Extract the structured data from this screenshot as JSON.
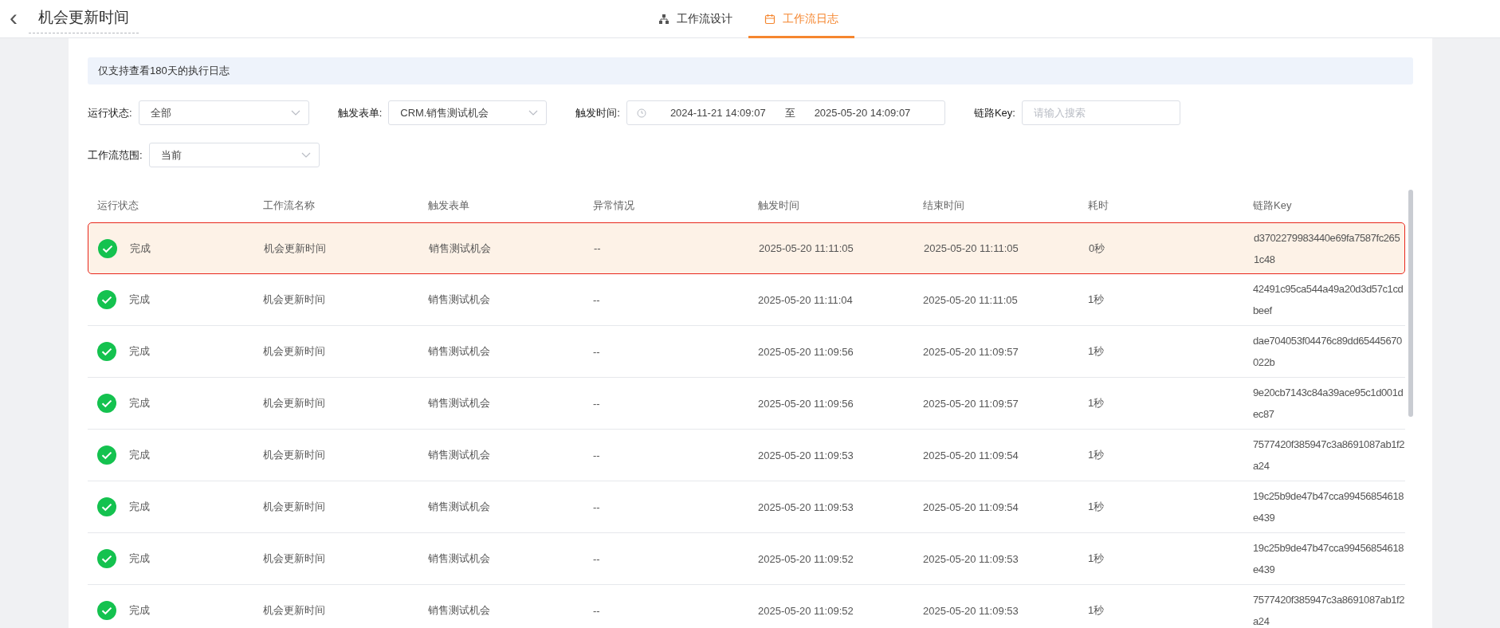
{
  "header": {
    "back": "‹",
    "title": "机会更新时间",
    "tabs": [
      {
        "label": "工作流设计",
        "kind": "flow",
        "selected": false
      },
      {
        "label": "工作流日志",
        "kind": "calendar",
        "selected": true
      }
    ]
  },
  "notice": "仅支持查看180天的执行日志",
  "filters": [
    {
      "label": "运行状态:",
      "kind": "select",
      "value": "全部"
    },
    {
      "label": "触发表单:",
      "kind": "select",
      "value": "CRM.销售测试机会"
    },
    {
      "label": "触发时间:",
      "kind": "range",
      "start": "2024-11-21 14:09:07",
      "separator": "至",
      "end": "2025-05-20 14:09:07"
    },
    {
      "label": "链路Key:",
      "kind": "input",
      "placeholder": "请输入搜索"
    },
    {
      "label": "工作流范围:",
      "kind": "select",
      "value": "当前"
    }
  ],
  "table": {
    "columns": [
      "运行状态",
      "工作流名称",
      "触发表单",
      "异常情况",
      "触发时间",
      "结束时间",
      "耗时",
      "链路Key"
    ],
    "rows": [
      {
        "selected": true,
        "kind": "done",
        "cells": [
          "完成",
          "机会更新时间",
          "销售测试机会",
          "--",
          "2025-05-20 11:11:05",
          "2025-05-20 11:11:05",
          "0秒",
          "d3702279983440e69fa7587fc2651c48"
        ]
      },
      {
        "selected": false,
        "kind": "done",
        "cells": [
          "完成",
          "机会更新时间",
          "销售测试机会",
          "--",
          "2025-05-20 11:11:04",
          "2025-05-20 11:11:05",
          "1秒",
          "42491c95ca544a49a20d3d57c1cdbeef"
        ]
      },
      {
        "selected": false,
        "kind": "done",
        "cells": [
          "完成",
          "机会更新时间",
          "销售测试机会",
          "--",
          "2025-05-20 11:09:56",
          "2025-05-20 11:09:57",
          "1秒",
          "dae704053f04476c89dd65445670022b"
        ]
      },
      {
        "selected": false,
        "kind": "done",
        "cells": [
          "完成",
          "机会更新时间",
          "销售测试机会",
          "--",
          "2025-05-20 11:09:56",
          "2025-05-20 11:09:57",
          "1秒",
          "9e20cb7143c84a39ace95c1d001dec87"
        ]
      },
      {
        "selected": false,
        "kind": "done",
        "cells": [
          "完成",
          "机会更新时间",
          "销售测试机会",
          "--",
          "2025-05-20 11:09:53",
          "2025-05-20 11:09:54",
          "1秒",
          "7577420f385947c3a8691087ab1f2a24"
        ]
      },
      {
        "selected": false,
        "kind": "done",
        "cells": [
          "完成",
          "机会更新时间",
          "销售测试机会",
          "--",
          "2025-05-20 11:09:53",
          "2025-05-20 11:09:54",
          "1秒",
          "19c25b9de47b47cca99456854618e439"
        ]
      },
      {
        "selected": false,
        "kind": "done",
        "cells": [
          "完成",
          "机会更新时间",
          "销售测试机会",
          "--",
          "2025-05-20 11:09:52",
          "2025-05-20 11:09:53",
          "1秒",
          "19c25b9de47b47cca99456854618e439"
        ]
      },
      {
        "selected": false,
        "kind": "done",
        "cells": [
          "完成",
          "机会更新时间",
          "销售测试机会",
          "--",
          "2025-05-20 11:09:52",
          "2025-05-20 11:09:53",
          "1秒",
          "7577420f385947c3a8691087ab1f2a24"
        ]
      }
    ]
  }
}
